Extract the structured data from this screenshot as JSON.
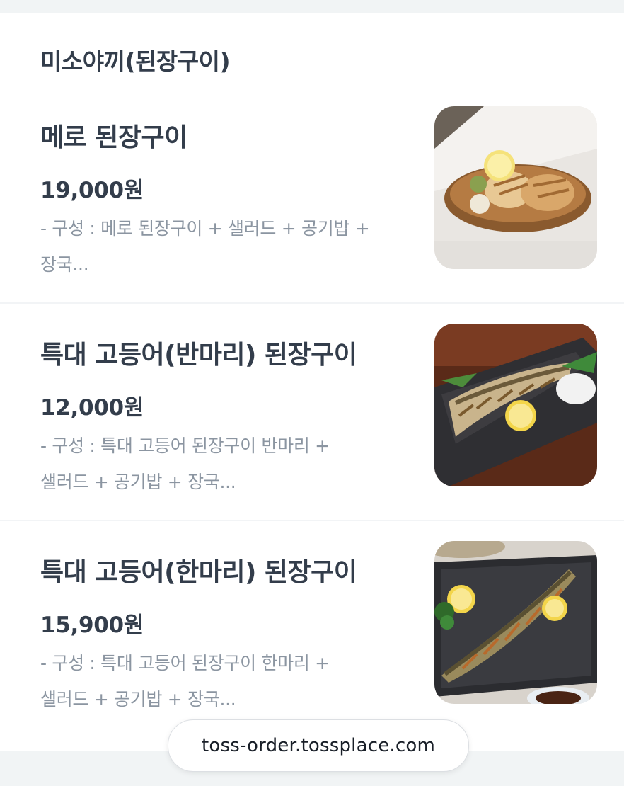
{
  "section": {
    "title": "미소야끼(된장구이)"
  },
  "menu_items": [
    {
      "name": "메로 된장구이",
      "price": "19,000원",
      "desc_line1": "- 구성 : 메로 된장구이 + 샐러드 + 공기밥 +",
      "desc_line2": "장국...",
      "image_icon": "grilled-fish-plate-photo"
    },
    {
      "name": "특대 고등어(반마리) 된장구이",
      "price": "12,000원",
      "desc_line1": "- 구성 : 특대 고등어 된장구이 반마리 +",
      "desc_line2": "샐러드 + 공기밥 + 장국...",
      "image_icon": "grilled-mackerel-photo"
    },
    {
      "name": "특대 고등어(한마리) 된장구이",
      "price": "15,900원",
      "desc_line1": "- 구성 : 특대 고등어 된장구이 한마리 +",
      "desc_line2": "샐러드 + 공기밥 + 장국...",
      "image_icon": "grilled-whole-mackerel-photo"
    }
  ],
  "footer": {
    "url": "toss-order.tossplace.com"
  },
  "colors": {
    "title_text": "#333d4b",
    "description_text": "#8b95a1",
    "background_band": "#f1f4f5",
    "divider": "#f2f4f6"
  }
}
